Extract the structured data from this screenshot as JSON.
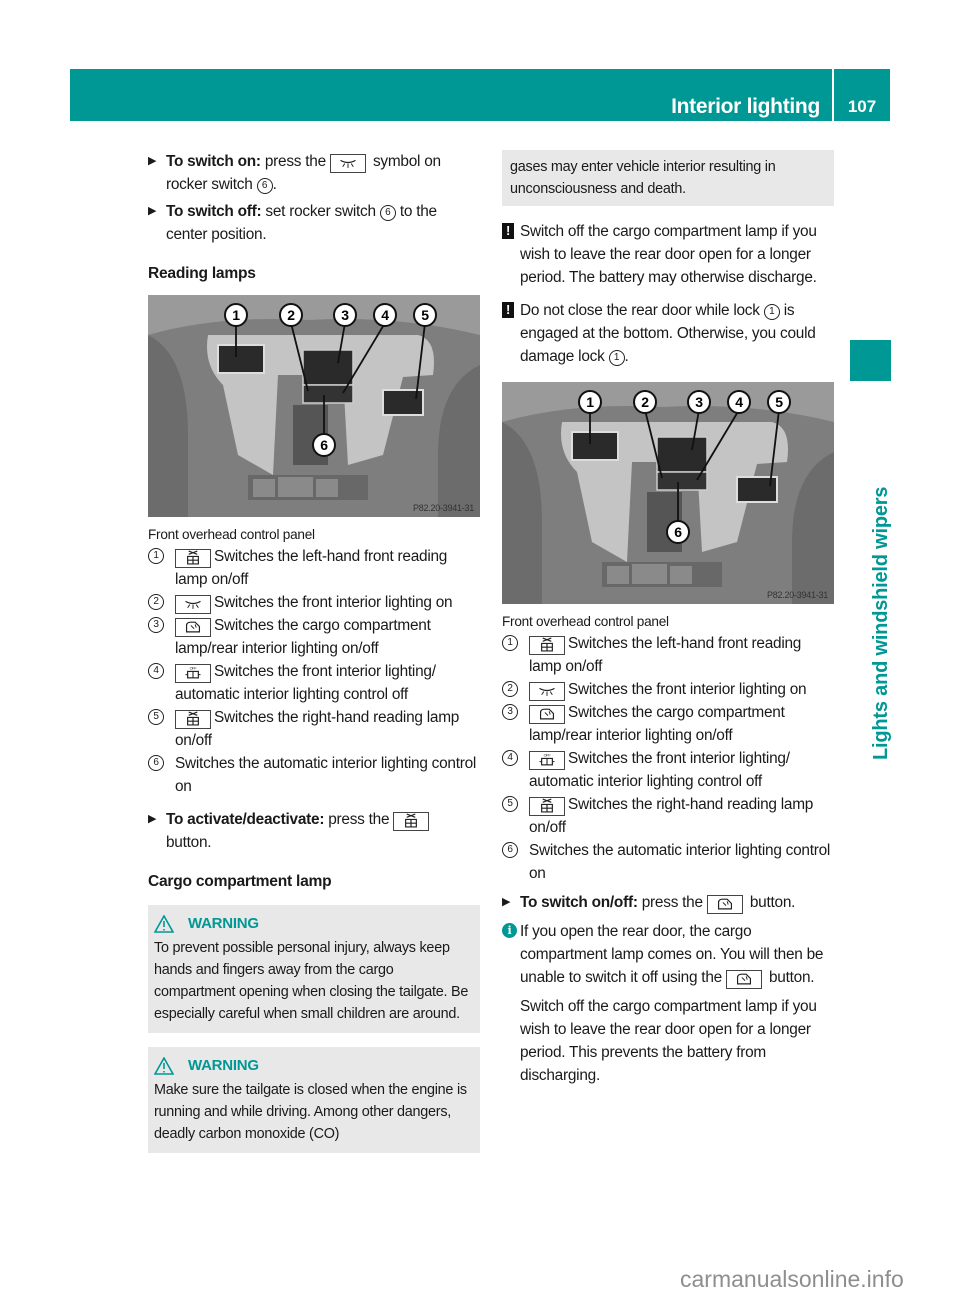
{
  "header": {
    "section_title": "Interior lighting",
    "page_number": "107",
    "side_tab": "Lights and windshield wipers",
    "accent_color": "#009894"
  },
  "left": {
    "steps_top": [
      {
        "bold": "To switch on:",
        "pre": "press the",
        "symbol": "front-interior-light-symbol",
        "post": "symbol on rocker switch",
        "ref": "6",
        "end": "."
      },
      {
        "bold": "To switch off:",
        "pre": "set rocker switch",
        "ref": "6",
        "post": "to the center position."
      }
    ],
    "reading_heading": "Reading lamps",
    "figure": {
      "caption": "Front overhead control panel",
      "code": "P82.20-3941-31",
      "callouts": [
        "1",
        "2",
        "3",
        "4",
        "5",
        "6"
      ]
    },
    "legend": [
      {
        "num": "1",
        "symbol": "reading-lamp-symbol",
        "text": "Switches the left-hand front reading lamp on/off"
      },
      {
        "num": "2",
        "symbol": "front-interior-light-symbol",
        "text": "Switches the front interior lighting on"
      },
      {
        "num": "3",
        "symbol": "cargo-lamp-symbol",
        "text": "Switches the cargo compartment lamp/rear interior lighting on/off"
      },
      {
        "num": "4",
        "symbol": "interior-light-off-symbol",
        "text": "Switches the front interior lighting/ automatic interior lighting control off"
      },
      {
        "num": "5",
        "symbol": "reading-lamp-symbol",
        "text": "Switches the right-hand reading lamp on/off"
      },
      {
        "num": "6",
        "symbol": "",
        "text": "Switches the automatic interior lighting control on"
      }
    ],
    "activate_step": {
      "bold": "To activate/deactivate:",
      "pre": "press the",
      "symbol": "reading-lamp-symbol",
      "post": "button."
    },
    "cargo_heading": "Cargo compartment lamp",
    "warning1": {
      "title": "WARNING",
      "text": "To prevent possible personal injury, always keep hands and fingers away from the cargo compartment opening when closing the tailgate. Be especially careful when small children are around."
    },
    "warning2": {
      "title": "WARNING",
      "text": "Make sure the tailgate is closed when the engine is running and while driving. Among other dangers, deadly carbon monoxide (CO)"
    }
  },
  "right": {
    "warning2_cont": "gases may enter vehicle interior resulting in unconsciousness and death.",
    "note1": "Switch off the cargo compartment lamp if you wish to leave the rear door open for a longer period. The battery may otherwise discharge.",
    "note2": {
      "pre": "Do not close the rear door while lock",
      "ref": "1",
      "mid": "is engaged at the bottom. Otherwise, you could damage lock",
      "ref2": "1",
      "end": "."
    },
    "figure": {
      "caption": "Front overhead control panel",
      "code": "P82.20-3941-31"
    },
    "legend": [
      {
        "num": "1",
        "text": "Switches the left-hand front reading lamp on/off"
      },
      {
        "num": "2",
        "text": "Switches the front interior lighting on"
      },
      {
        "num": "3",
        "text": "Switches the cargo compartment lamp/rear interior lighting on/off"
      },
      {
        "num": "4",
        "text": "Switches the front interior lighting/ automatic interior lighting control off"
      },
      {
        "num": "5",
        "text": "Switches the right-hand reading lamp on/off"
      },
      {
        "num": "6",
        "text": "Switches the automatic interior lighting control on"
      }
    ],
    "switch_step": {
      "bold": "To switch on/off:",
      "pre": "press the",
      "post": "button."
    },
    "info": {
      "p1_pre": "If you open the rear door, the cargo compartment lamp comes on. You will then be unable to switch it off using the",
      "p1_post": "button.",
      "p2": "Switch off the cargo compartment lamp if you wish to leave the rear door open for a longer period. This prevents the battery from discharging."
    }
  },
  "symbols": {
    "reading_lamp": "⌂",
    "front_light": "⌔",
    "cargo_lamp": "♨",
    "light_off": "OFF"
  },
  "watermark": "carmanualsonline.info"
}
